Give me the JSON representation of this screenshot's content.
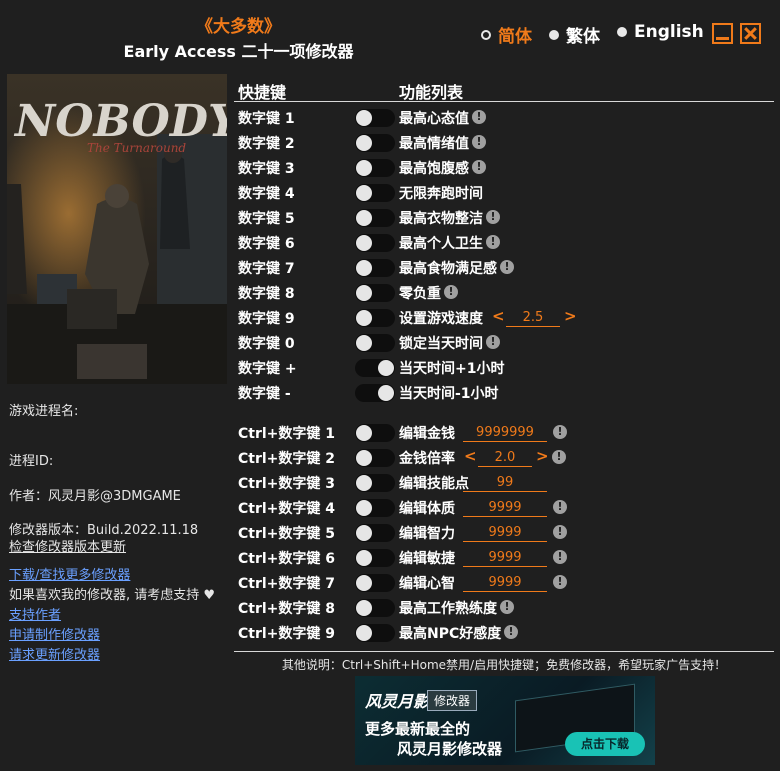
{
  "header": {
    "title": "《大多数》",
    "subtitle": "Early Access 二十一项修改器"
  },
  "languages": [
    {
      "label": "简体",
      "selected": true
    },
    {
      "label": "繁体",
      "selected": false
    },
    {
      "label": "English",
      "selected": false
    }
  ],
  "cover": {
    "logo_text": "NOBODY",
    "logo_sub": "The Turnaround"
  },
  "left_panel": {
    "process_label": "游戏进程名:",
    "pid_label": "进程ID:",
    "author": "作者：风灵月影@3DMGAME",
    "version": "修改器版本：Build.2022.11.18",
    "check_update": "检查修改器版本更新",
    "download_more": "下载/查找更多修改器",
    "support_text": "如果喜欢我的修改器, 请考虑支持",
    "support_author": "支持作者",
    "request_trainer": "申请制作修改器",
    "request_update": "请求更新修改器"
  },
  "table": {
    "col_hotkey": "快捷键",
    "col_functions": "功能列表"
  },
  "rows": [
    {
      "key": "数字键 1",
      "func": "最高心态值",
      "info": true,
      "on": false
    },
    {
      "key": "数字键 2",
      "func": "最高情绪值",
      "info": true,
      "on": false
    },
    {
      "key": "数字键 3",
      "func": "最高饱腹感",
      "info": true,
      "on": false
    },
    {
      "key": "数字键 4",
      "func": "无限奔跑时间",
      "info": false,
      "on": false
    },
    {
      "key": "数字键 5",
      "func": "最高衣物整洁",
      "info": true,
      "on": false
    },
    {
      "key": "数字键 6",
      "func": "最高个人卫生",
      "info": true,
      "on": false
    },
    {
      "key": "数字键 7",
      "func": "最高食物满足感",
      "info": true,
      "on": false
    },
    {
      "key": "数字键 8",
      "func": "零负重",
      "info": true,
      "on": false
    },
    {
      "key": "数字键 9",
      "func": "设置游戏速度",
      "info": false,
      "on": false,
      "arrows": true,
      "value": "2.5"
    },
    {
      "key": "数字键 0",
      "func": "锁定当天时间",
      "info": true,
      "on": false
    },
    {
      "key": "数字键 +",
      "func": "当天时间+1小时",
      "info": false,
      "on": true
    },
    {
      "key": "数字键 -",
      "func": "当天时间-1小时",
      "info": false,
      "on": true
    },
    {
      "key": "Ctrl+数字键 1",
      "func": "编辑金钱",
      "info": true,
      "on": false,
      "value": "9999999"
    },
    {
      "key": "Ctrl+数字键 2",
      "func": "金钱倍率",
      "info": true,
      "on": false,
      "arrows": true,
      "value": "2.0"
    },
    {
      "key": "Ctrl+数字键 3",
      "func": "编辑技能点",
      "info": false,
      "on": false,
      "value": "99"
    },
    {
      "key": "Ctrl+数字键 4",
      "func": "编辑体质",
      "info": true,
      "on": false,
      "value": "9999"
    },
    {
      "key": "Ctrl+数字键 5",
      "func": "编辑智力",
      "info": true,
      "on": false,
      "value": "9999"
    },
    {
      "key": "Ctrl+数字键 6",
      "func": "编辑敏捷",
      "info": true,
      "on": false,
      "value": "9999"
    },
    {
      "key": "Ctrl+数字键 7",
      "func": "编辑心智",
      "info": true,
      "on": false,
      "value": "9999"
    },
    {
      "key": "Ctrl+数字键 8",
      "func": "最高工作熟练度",
      "info": true,
      "on": false
    },
    {
      "key": "Ctrl+数字键 9",
      "func": "最高NPC好感度",
      "info": true,
      "on": false
    }
  ],
  "footer": {
    "note": "其他说明：Ctrl+Shift+Home禁用/启用快捷键；免费修改器，希望玩家广告支持！"
  },
  "ad": {
    "logo": "风灵月影",
    "tag": "修改器",
    "line1": "更多最新最全的",
    "line2": "风灵月影修改器",
    "button": "点击下载"
  },
  "colors": {
    "accent": "#f07a1a",
    "background": "#1f1f1f",
    "link": "#6aa0ff"
  }
}
